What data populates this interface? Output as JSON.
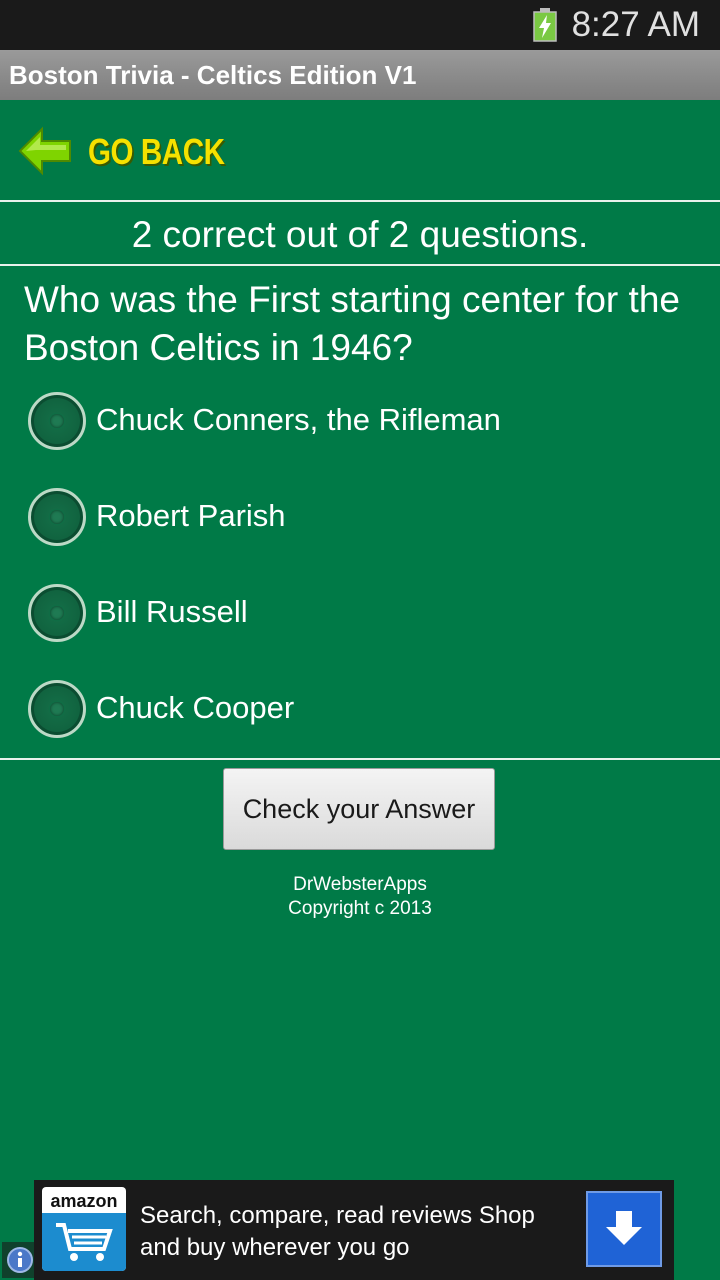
{
  "status_bar": {
    "time": "8:27 AM",
    "battery_icon": "battery-charging-icon"
  },
  "app": {
    "title": "Boston Trivia - Celtics Edition V1"
  },
  "nav": {
    "back_label": "GO BACK",
    "back_icon": "arrow-left-icon"
  },
  "quiz": {
    "score": "2 correct out of 2 questions.",
    "question": "Who was the First starting center for the Boston Celtics in 1946?",
    "options": [
      {
        "label": "Chuck Conners, the Rifleman",
        "selected": false
      },
      {
        "label": "Robert Parish",
        "selected": false
      },
      {
        "label": "Bill Russell",
        "selected": false
      },
      {
        "label": "Chuck Cooper",
        "selected": false
      }
    ],
    "check_button": "Check your Answer"
  },
  "footer": {
    "developer": "DrWebsterApps",
    "copyright": "Copyright c 2013"
  },
  "ad": {
    "brand": "amazon",
    "text": "Search, compare, read reviews Shop and buy wherever you go",
    "download_icon": "download-arrow-icon",
    "info_icon": "info-icon"
  },
  "colors": {
    "background": "#007a47",
    "back_label": "#f5e100",
    "back_arrow": "#7fd400",
    "ad_button": "#1f63d6"
  }
}
